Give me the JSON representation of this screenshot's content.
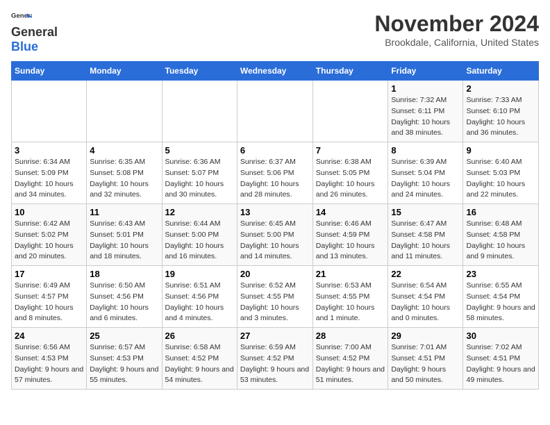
{
  "header": {
    "logo_line1": "General",
    "logo_line2": "Blue",
    "month": "November 2024",
    "location": "Brookdale, California, United States"
  },
  "weekdays": [
    "Sunday",
    "Monday",
    "Tuesday",
    "Wednesday",
    "Thursday",
    "Friday",
    "Saturday"
  ],
  "weeks": [
    [
      {
        "day": "",
        "info": ""
      },
      {
        "day": "",
        "info": ""
      },
      {
        "day": "",
        "info": ""
      },
      {
        "day": "",
        "info": ""
      },
      {
        "day": "",
        "info": ""
      },
      {
        "day": "1",
        "info": "Sunrise: 7:32 AM\nSunset: 6:11 PM\nDaylight: 10 hours and 38 minutes."
      },
      {
        "day": "2",
        "info": "Sunrise: 7:33 AM\nSunset: 6:10 PM\nDaylight: 10 hours and 36 minutes."
      }
    ],
    [
      {
        "day": "3",
        "info": "Sunrise: 6:34 AM\nSunset: 5:09 PM\nDaylight: 10 hours and 34 minutes."
      },
      {
        "day": "4",
        "info": "Sunrise: 6:35 AM\nSunset: 5:08 PM\nDaylight: 10 hours and 32 minutes."
      },
      {
        "day": "5",
        "info": "Sunrise: 6:36 AM\nSunset: 5:07 PM\nDaylight: 10 hours and 30 minutes."
      },
      {
        "day": "6",
        "info": "Sunrise: 6:37 AM\nSunset: 5:06 PM\nDaylight: 10 hours and 28 minutes."
      },
      {
        "day": "7",
        "info": "Sunrise: 6:38 AM\nSunset: 5:05 PM\nDaylight: 10 hours and 26 minutes."
      },
      {
        "day": "8",
        "info": "Sunrise: 6:39 AM\nSunset: 5:04 PM\nDaylight: 10 hours and 24 minutes."
      },
      {
        "day": "9",
        "info": "Sunrise: 6:40 AM\nSunset: 5:03 PM\nDaylight: 10 hours and 22 minutes."
      }
    ],
    [
      {
        "day": "10",
        "info": "Sunrise: 6:42 AM\nSunset: 5:02 PM\nDaylight: 10 hours and 20 minutes."
      },
      {
        "day": "11",
        "info": "Sunrise: 6:43 AM\nSunset: 5:01 PM\nDaylight: 10 hours and 18 minutes."
      },
      {
        "day": "12",
        "info": "Sunrise: 6:44 AM\nSunset: 5:00 PM\nDaylight: 10 hours and 16 minutes."
      },
      {
        "day": "13",
        "info": "Sunrise: 6:45 AM\nSunset: 5:00 PM\nDaylight: 10 hours and 14 minutes."
      },
      {
        "day": "14",
        "info": "Sunrise: 6:46 AM\nSunset: 4:59 PM\nDaylight: 10 hours and 13 minutes."
      },
      {
        "day": "15",
        "info": "Sunrise: 6:47 AM\nSunset: 4:58 PM\nDaylight: 10 hours and 11 minutes."
      },
      {
        "day": "16",
        "info": "Sunrise: 6:48 AM\nSunset: 4:58 PM\nDaylight: 10 hours and 9 minutes."
      }
    ],
    [
      {
        "day": "17",
        "info": "Sunrise: 6:49 AM\nSunset: 4:57 PM\nDaylight: 10 hours and 8 minutes."
      },
      {
        "day": "18",
        "info": "Sunrise: 6:50 AM\nSunset: 4:56 PM\nDaylight: 10 hours and 6 minutes."
      },
      {
        "day": "19",
        "info": "Sunrise: 6:51 AM\nSunset: 4:56 PM\nDaylight: 10 hours and 4 minutes."
      },
      {
        "day": "20",
        "info": "Sunrise: 6:52 AM\nSunset: 4:55 PM\nDaylight: 10 hours and 3 minutes."
      },
      {
        "day": "21",
        "info": "Sunrise: 6:53 AM\nSunset: 4:55 PM\nDaylight: 10 hours and 1 minute."
      },
      {
        "day": "22",
        "info": "Sunrise: 6:54 AM\nSunset: 4:54 PM\nDaylight: 10 hours and 0 minutes."
      },
      {
        "day": "23",
        "info": "Sunrise: 6:55 AM\nSunset: 4:54 PM\nDaylight: 9 hours and 58 minutes."
      }
    ],
    [
      {
        "day": "24",
        "info": "Sunrise: 6:56 AM\nSunset: 4:53 PM\nDaylight: 9 hours and 57 minutes."
      },
      {
        "day": "25",
        "info": "Sunrise: 6:57 AM\nSunset: 4:53 PM\nDaylight: 9 hours and 55 minutes."
      },
      {
        "day": "26",
        "info": "Sunrise: 6:58 AM\nSunset: 4:52 PM\nDaylight: 9 hours and 54 minutes."
      },
      {
        "day": "27",
        "info": "Sunrise: 6:59 AM\nSunset: 4:52 PM\nDaylight: 9 hours and 53 minutes."
      },
      {
        "day": "28",
        "info": "Sunrise: 7:00 AM\nSunset: 4:52 PM\nDaylight: 9 hours and 51 minutes."
      },
      {
        "day": "29",
        "info": "Sunrise: 7:01 AM\nSunset: 4:51 PM\nDaylight: 9 hours and 50 minutes."
      },
      {
        "day": "30",
        "info": "Sunrise: 7:02 AM\nSunset: 4:51 PM\nDaylight: 9 hours and 49 minutes."
      }
    ]
  ]
}
